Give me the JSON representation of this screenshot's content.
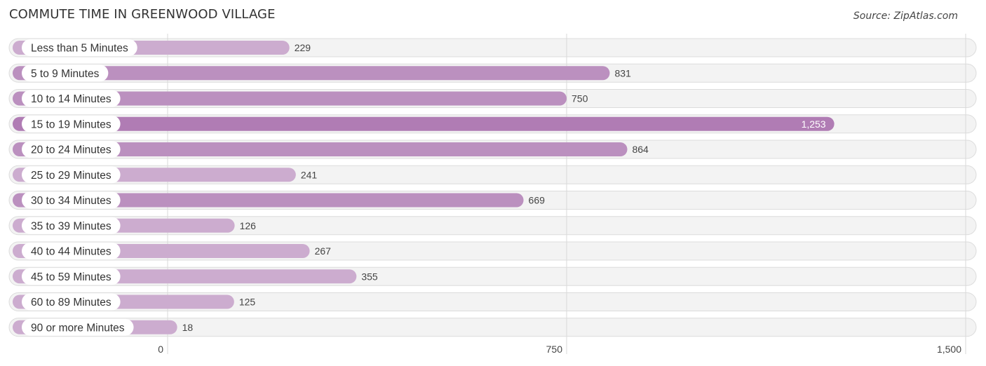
{
  "header": {
    "title": "COMMUTE TIME IN GREENWOOD VILLAGE",
    "source": "Source: ZipAtlas.com"
  },
  "chart_data": {
    "type": "bar",
    "orientation": "horizontal",
    "title": "COMMUTE TIME IN GREENWOOD VILLAGE",
    "source": "Source: ZipAtlas.com",
    "xlabel": "",
    "ylabel": "",
    "xlim": [
      0,
      1500
    ],
    "xticks": [
      0,
      750,
      1500
    ],
    "xtick_labels": [
      "0",
      "750",
      "1,500"
    ],
    "grid": true,
    "categories": [
      "Less than 5 Minutes",
      "5 to 9 Minutes",
      "10 to 14 Minutes",
      "15 to 19 Minutes",
      "20 to 24 Minutes",
      "25 to 29 Minutes",
      "30 to 34 Minutes",
      "35 to 39 Minutes",
      "40 to 44 Minutes",
      "45 to 59 Minutes",
      "60 to 89 Minutes",
      "90 or more Minutes"
    ],
    "values": [
      229,
      831,
      750,
      1253,
      864,
      241,
      669,
      126,
      267,
      355,
      125,
      18
    ],
    "value_labels": [
      "229",
      "831",
      "750",
      "1,253",
      "864",
      "241",
      "669",
      "126",
      "267",
      "355",
      "125",
      "18"
    ],
    "colors": {
      "bar_strong": "#b07cb4",
      "bar_mid": "#bb90bf",
      "bar_light": "#ccaccf",
      "track": "#f3f3f3",
      "label_text": "#333333",
      "value_text": "#444444"
    }
  }
}
